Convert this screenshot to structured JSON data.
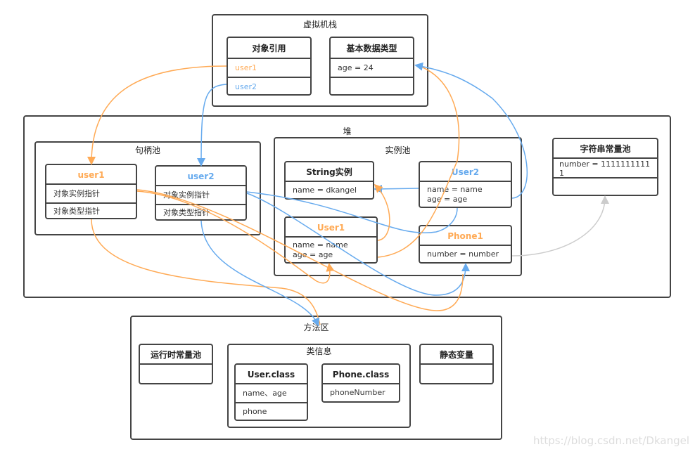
{
  "colors": {
    "orange": "#FFAA55",
    "blue": "#66AAEE",
    "gray": "#CCCCCC",
    "border": "#444444"
  },
  "stack": {
    "title": "虚拟机栈",
    "refs": {
      "title": "对象引用",
      "rows": [
        "user1",
        "user2"
      ]
    },
    "primitives": {
      "title": "基本数据类型",
      "rows": [
        "age = 24",
        ""
      ]
    }
  },
  "heap": {
    "title": "堆",
    "handle_pool": {
      "title": "句柄池",
      "user1": {
        "title": "user1",
        "rows": [
          "对象实例指针",
          "对象类型指针"
        ]
      },
      "user2": {
        "title": "user2",
        "rows": [
          "对象实例指针",
          "对象类型指针"
        ]
      }
    },
    "instance_pool": {
      "title": "实例池",
      "string": {
        "title": "String实例",
        "rows": [
          "name = dkangel"
        ]
      },
      "user2": {
        "title": "User2",
        "rows": [
          "name = name\nage = age"
        ]
      },
      "user1": {
        "title": "User1",
        "rows": [
          "name = name\nage = age"
        ]
      },
      "phone1": {
        "title": "Phone1",
        "rows": [
          "number = number"
        ]
      }
    },
    "string_pool": {
      "title": "字符串常量池",
      "rows": [
        "number = 11111111111",
        ""
      ]
    }
  },
  "method_area": {
    "title": "方法区",
    "runtime_pool": {
      "title": "运行时常量池"
    },
    "class_info": {
      "title": "类信息",
      "user_class": {
        "title": "User.class",
        "rows": [
          "name、age",
          "phone"
        ]
      },
      "phone_class": {
        "title": "Phone.class",
        "rows": [
          "phoneNumber"
        ]
      }
    },
    "static_vars": {
      "title": "静态变量"
    }
  },
  "watermark": "https://blog.csdn.net/Dkangel"
}
